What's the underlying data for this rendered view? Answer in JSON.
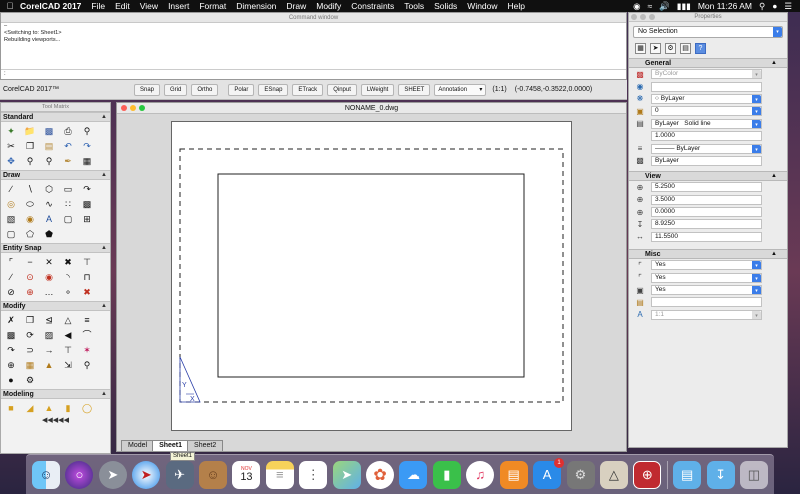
{
  "menubar": {
    "app_name": "CorelCAD 2017",
    "menus": [
      "File",
      "Edit",
      "View",
      "Insert",
      "Format",
      "Dimension",
      "Draw",
      "Modify",
      "Constraints",
      "Tools",
      "Solids",
      "Window",
      "Help"
    ],
    "clock": "Mon 11:26 AM"
  },
  "command_window": {
    "title": "Command window",
    "lines": [
      "–",
      "<Switching to: Sheet1>",
      "Rebuilding viewports..."
    ],
    "prompt": ":"
  },
  "statusbar": {
    "app_label": "CorelCAD 2017™",
    "buttons": [
      "Snap",
      "Grid",
      "Ortho",
      "Polar",
      "ESnap",
      "ETrack",
      "Qinput",
      "LWeight",
      "SHEET"
    ],
    "annotation_select": "Annotation",
    "scale": "(1:1)",
    "coordinates": "(-0.7458,-0.3522,0.0000)"
  },
  "tool_matrix": {
    "title": "Tool Matrix",
    "sections": {
      "standard": "Standard",
      "draw": "Draw",
      "entity_snap": "Entity Snap",
      "modify": "Modify",
      "modeling": "Modeling"
    },
    "more": "◀◀◀◀◀"
  },
  "drawing": {
    "title": "NONAME_0.dwg",
    "tabs": [
      "Model",
      "Sheet1",
      "Sheet2"
    ],
    "active_tab": "Sheet1",
    "ucs_y": "Y",
    "ucs_x": "X"
  },
  "properties": {
    "title": "Properties",
    "selection": "No Selection",
    "general": {
      "header": "General",
      "color": "ByColor",
      "layer": "ByLayer",
      "layer_index": "0",
      "linetype_label": "ByLayer",
      "linetype_name": "Solid line",
      "scale": "1.0000",
      "lineweight": "ByLayer",
      "print_style": "ByLayer"
    },
    "view": {
      "header": "View",
      "values": [
        "5.2500",
        "3.5000",
        "0.0000",
        "8.9250",
        "11.5500"
      ]
    },
    "misc": {
      "header": "Misc",
      "values": [
        "Yes",
        "Yes",
        "Yes",
        "",
        "1:1"
      ]
    }
  },
  "dock": {
    "tooltip": "Sheet1",
    "calendar_month": "NOV",
    "calendar_day": "13",
    "appstore_badge": "1"
  },
  "colors": {
    "accent_blue": "#3b7de9",
    "menubar": "#101010",
    "desktop": "#5a3a55"
  }
}
